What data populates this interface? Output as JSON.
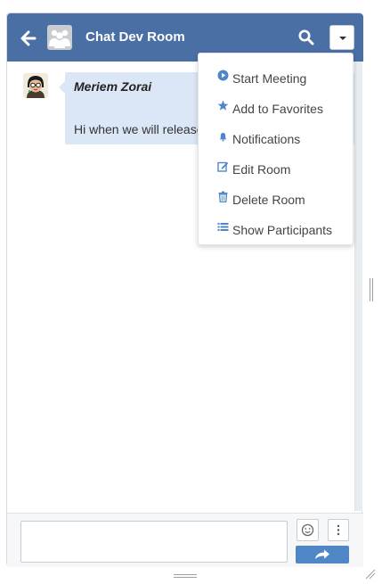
{
  "header": {
    "room_title": "Chat Dev Room",
    "accent": "#4a6fa5"
  },
  "messages": [
    {
      "sender": "Meriem Zorai",
      "text": "Hi when we will release"
    }
  ],
  "menu": {
    "items": [
      {
        "label": "Start Meeting",
        "icon": "play-circle-icon"
      },
      {
        "label": "Add to Favorites",
        "icon": "star-icon"
      },
      {
        "label": "Notifications",
        "icon": "bell-icon"
      },
      {
        "label": "Edit Room",
        "icon": "edit-icon"
      },
      {
        "label": "Delete Room",
        "icon": "trash-icon"
      },
      {
        "label": "Show Participants",
        "icon": "list-icon"
      }
    ],
    "icon_color": "#4f86c6"
  },
  "composer": {
    "message_value": "",
    "send_color": "#4f86c6"
  }
}
